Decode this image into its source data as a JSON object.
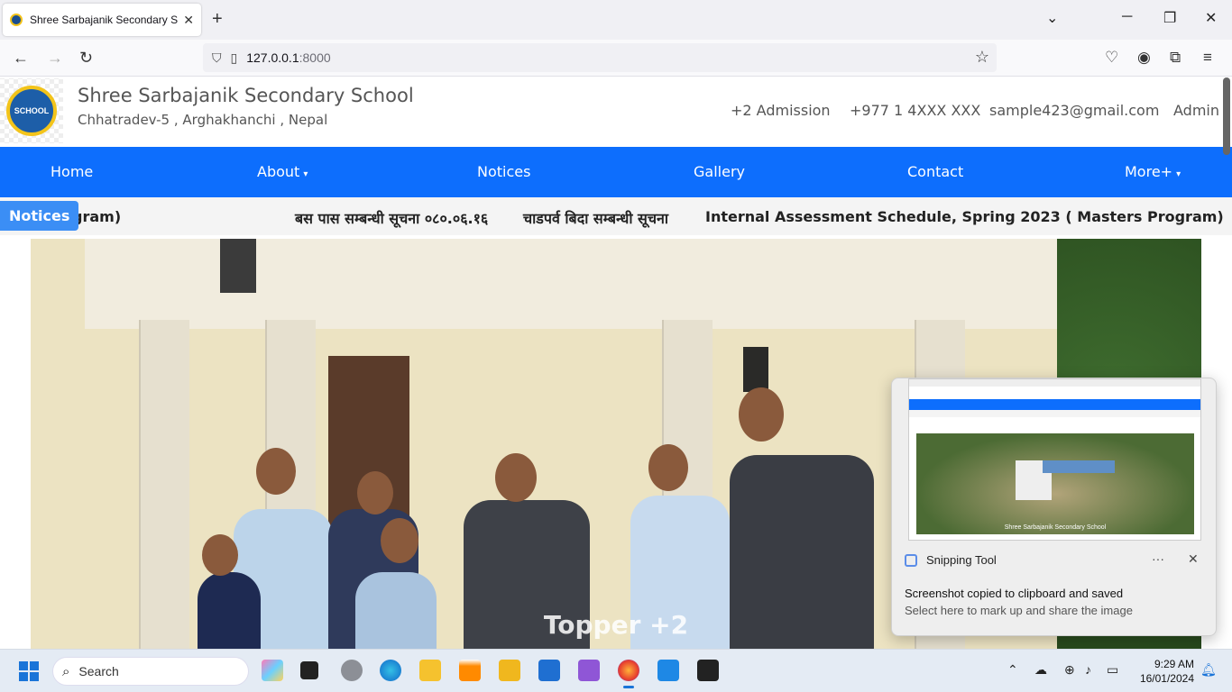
{
  "browser": {
    "tab_title": "Shree Sarbajanik Secondary School",
    "tab_close": "✕",
    "new_tab": "+",
    "url_host": "127.0.0.1",
    "url_port": ":8000"
  },
  "site": {
    "name": "Shree Sarbajanik Secondary School",
    "address": "Chhatradev-5 , Arghakhanchi , Nepal",
    "logo_text": "SCHOOL",
    "header_links": [
      "+2 Admission",
      "+977 1 4XXX XXX",
      "sample423@gmail.com",
      "Admin"
    ],
    "nav": [
      {
        "label": "Home"
      },
      {
        "label": "About",
        "caret": "▾"
      },
      {
        "label": "Notices"
      },
      {
        "label": "Gallery"
      },
      {
        "label": "Contact"
      },
      {
        "label": "More+",
        "caret": "▾"
      }
    ],
    "ticker": {
      "badge": "Notices",
      "items": [
        "gram)",
        "बस पास सम्बन्धी सूचना ०८०.०६.१६",
        "चाडपर्व बिदा सम्बन्धी सूचना",
        "Internal Assessment Schedule, Spring 2023 ( Masters Program)"
      ]
    },
    "hero_caption": "Topper +2"
  },
  "toast": {
    "app_name": "Snipping Tool",
    "more": "···",
    "close": "✕",
    "title": "Screenshot copied to clipboard and saved",
    "body": "Select here to mark up and share the image",
    "thumb_caption": "Shree Sarbajanik Secondary School"
  },
  "taskbar": {
    "search_label": "Search",
    "time": "9:29 AM",
    "date": "16/01/2024"
  }
}
